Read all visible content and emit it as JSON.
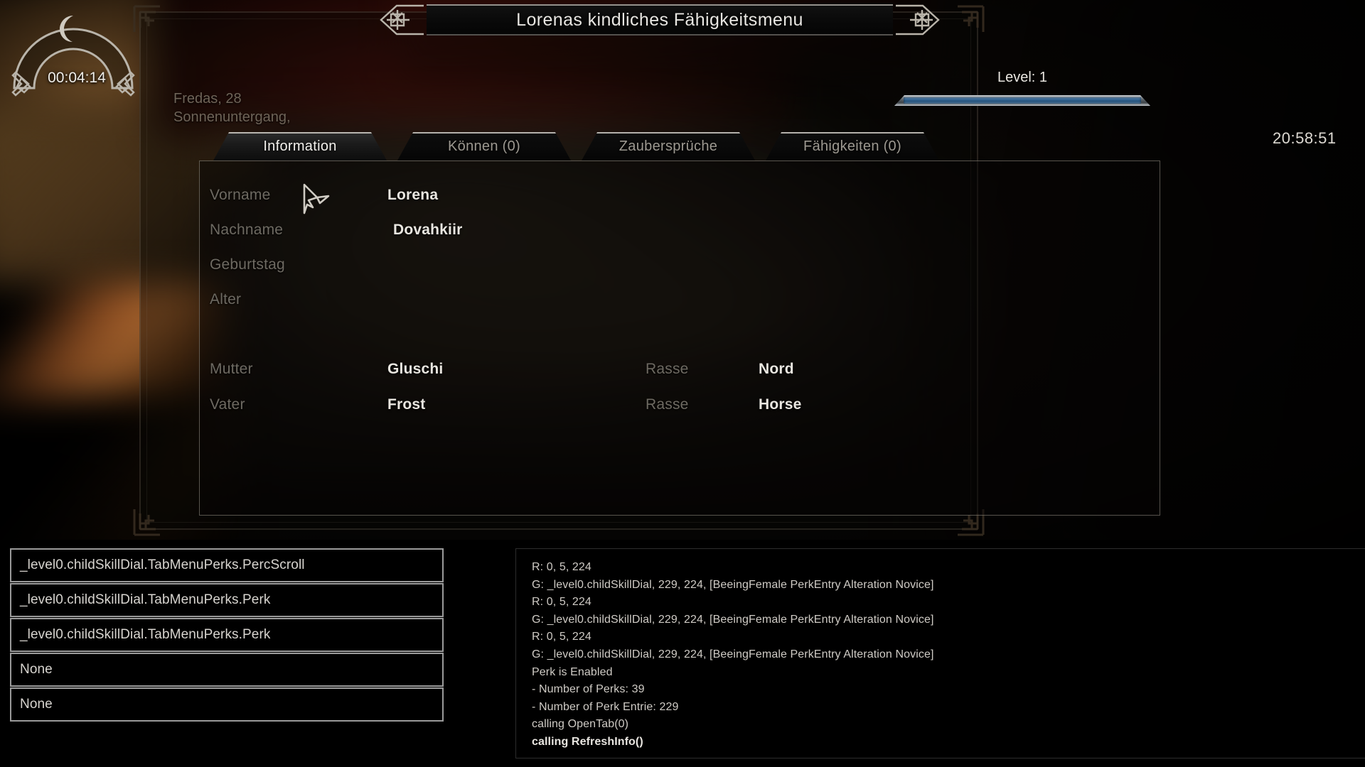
{
  "hud": {
    "arch_icon": "crescent-moon-icon",
    "timer": "00:04:14",
    "game_date": "Fredas, 28 Sonnenuntergang,",
    "wall_clock": "20:58:51"
  },
  "menu": {
    "title": "Lorenas kindliches Fähigkeitsmenu",
    "level_label": "Level: 1",
    "xp_percent": 100,
    "accent_color": "#3d6e9c",
    "frame_color": "#968a78"
  },
  "tabs": [
    {
      "label": "Information",
      "active": true
    },
    {
      "label": "Können (0)",
      "active": false
    },
    {
      "label": "Zaubersprüche",
      "active": false
    },
    {
      "label": "Fähigkeiten (0)",
      "active": false
    }
  ],
  "info": {
    "fields_left": [
      {
        "label": "Vorname",
        "value": "Lorena"
      },
      {
        "label": "Nachname",
        "value": "Dovahkiir"
      },
      {
        "label": "Geburtstag",
        "value": ""
      },
      {
        "label": "Alter",
        "value": ""
      }
    ],
    "parents": [
      {
        "label": "Mutter",
        "value": "Gluschi",
        "race_label": "Rasse",
        "race_value": "Nord"
      },
      {
        "label": "Vater",
        "value": "Frost",
        "race_label": "Rasse",
        "race_value": "Horse"
      }
    ]
  },
  "debug": {
    "paths": [
      "_level0.childSkillDial.TabMenuPerks.PercScroll",
      "_level0.childSkillDial.TabMenuPerks.Perk",
      "_level0.childSkillDial.TabMenuPerks.Perk",
      "None",
      "None"
    ],
    "log": [
      {
        "text": "R: 0, 5, 224",
        "bold": false
      },
      {
        "text": "G: _level0.childSkillDial, 229, 224, [BeeingFemale PerkEntry Alteration Novice]",
        "bold": false
      },
      {
        "text": "R: 0, 5, 224",
        "bold": false
      },
      {
        "text": "G: _level0.childSkillDial, 229, 224, [BeeingFemale PerkEntry Alteration Novice]",
        "bold": false
      },
      {
        "text": "R: 0, 5, 224",
        "bold": false
      },
      {
        "text": "G: _level0.childSkillDial, 229, 224, [BeeingFemale PerkEntry Alteration Novice]",
        "bold": false
      },
      {
        "text": "Perk is Enabled",
        "bold": false
      },
      {
        "text": "- Number of Perks: 39",
        "bold": false
      },
      {
        "text": "- Number of Perk Entrie: 229",
        "bold": false
      },
      {
        "text": "calling OpenTab(0)",
        "bold": false
      },
      {
        "text": "calling RefreshInfo()",
        "bold": true
      }
    ]
  },
  "cursor": {
    "icon": "skyrim-arrow-cursor"
  }
}
